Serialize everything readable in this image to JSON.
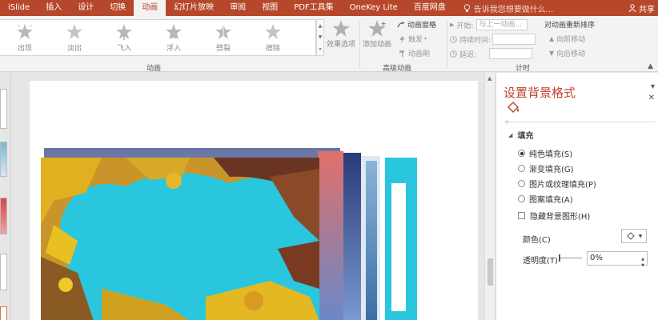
{
  "tabs": [
    {
      "label": "iSlide",
      "active": false
    },
    {
      "label": "插入",
      "active": false
    },
    {
      "label": "设计",
      "active": false
    },
    {
      "label": "切换",
      "active": false
    },
    {
      "label": "动画",
      "active": true
    },
    {
      "label": "幻灯片放映",
      "active": false
    },
    {
      "label": "审阅",
      "active": false
    },
    {
      "label": "视图",
      "active": false
    },
    {
      "label": "PDF工具集",
      "active": false
    },
    {
      "label": "OneKey Lite",
      "active": false
    },
    {
      "label": "百度网盘",
      "active": false
    }
  ],
  "tell_me": "告诉我您想要做什么...",
  "share": "共享",
  "ribbon": {
    "gallery": [
      {
        "label": "出现",
        "icon": "star-burst-icon"
      },
      {
        "label": "淡出",
        "icon": "star-icon"
      },
      {
        "label": "飞入",
        "icon": "star-fly-icon"
      },
      {
        "label": "浮入",
        "icon": "star-float-icon"
      },
      {
        "label": "劈裂",
        "icon": "star-split-icon"
      },
      {
        "label": "擦除",
        "icon": "star-wipe-icon"
      }
    ],
    "effect_options": "效果选项",
    "group_animation": "动画",
    "add_animation": "添加动画",
    "animation_pane": "动画窗格",
    "trigger": "触发",
    "painter": "动画刷",
    "group_advanced": "高级动画",
    "start_label": "开始:",
    "start_value": "与上一动画...",
    "duration_label": "持续时间:",
    "delay_label": "延迟:",
    "group_timing": "计时",
    "reorder_title": "对动画重新排序",
    "move_earlier": "向前移动",
    "move_later": "向后移动"
  },
  "pane": {
    "title": "设置背景格式",
    "section_fill": "填充",
    "options": [
      {
        "label": "纯色填充(S)",
        "checked": true
      },
      {
        "label": "渐变填充(G)",
        "checked": false
      },
      {
        "label": "图片或纹理填充(P)",
        "checked": false
      },
      {
        "label": "图案填充(A)",
        "checked": false
      }
    ],
    "hide_bg": "隐藏背景图形(H)",
    "color_label": "颜色(C)",
    "transparency_label": "透明度(T)",
    "transparency_value": "0%"
  },
  "colors": {
    "accent": "#b7472a",
    "pane_title": "#c1432a",
    "slide_cyan": "#29c6de"
  }
}
